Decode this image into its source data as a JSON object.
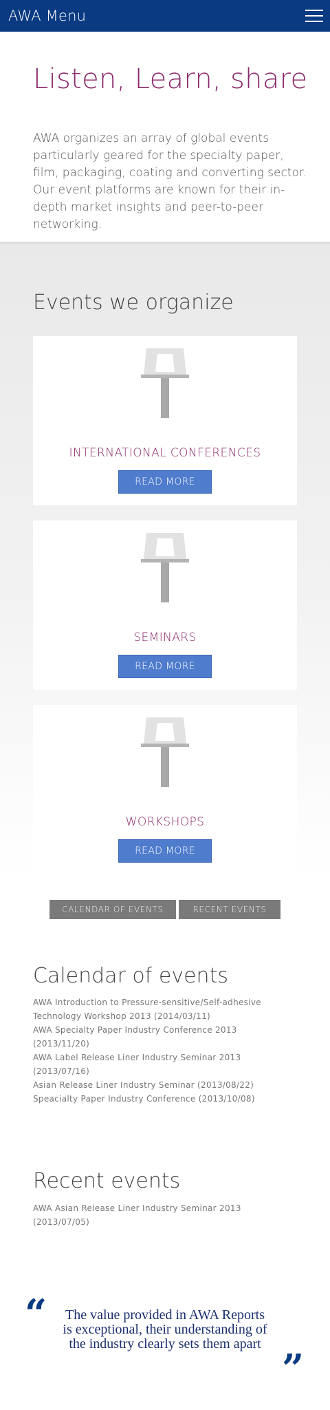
{
  "header": {
    "title": "AWA Menu",
    "menu_icon": "hamburger-menu-icon"
  },
  "intro": {
    "heading": "Listen, Learn, share",
    "body": "AWA organizes an array of global events particularly geared for the specialty paper, film, packaging, coating and converting sector. Our event platforms are known for their in-depth market insights and peer-to-peer networking."
  },
  "events": {
    "heading": "Events we organize",
    "icon": "podium-icon",
    "cards": [
      {
        "title": "INTERNATIONAL CONFERENCES",
        "button": "READ MORE"
      },
      {
        "title": "SEMINARS",
        "button": "READ MORE"
      },
      {
        "title": "WORKSHOPS",
        "button": "READ MORE"
      }
    ]
  },
  "tabs": {
    "calendar": "CALENDAR OF EVENTS",
    "recent": "RECENT EVENTS"
  },
  "calendar": {
    "heading": "Calendar of events",
    "items": [
      "AWA Introduction to Pressure-sensitive/Self-adhesive Technology Workshop 2013 (2014/03/11)",
      "AWA Specialty Paper Industry Conference 2013 (2013/11/20)",
      "AWA Label Release Liner Industry Seminar 2013 (2013/07/16)",
      "Asian Release Liner Industry Seminar (2013/08/22)",
      "Speacialty Paper Industry Conference (2013/10/08)"
    ]
  },
  "recent": {
    "heading": "Recent events",
    "items": [
      "AWA Asian Release Liner Industry Seminar 2013 (2013/07/05)"
    ]
  },
  "testimonial": {
    "quote": "The value provided in AWA Reports is exceptional, their understanding of the industry clearly sets them apart",
    "open_mark": "“",
    "close_mark": "”"
  },
  "colors": {
    "brand_blue": "#0a3a82",
    "accent_purple": "#8b2a6b",
    "button_blue": "#4f7ccc",
    "tab_gray": "#7a7a7a"
  }
}
